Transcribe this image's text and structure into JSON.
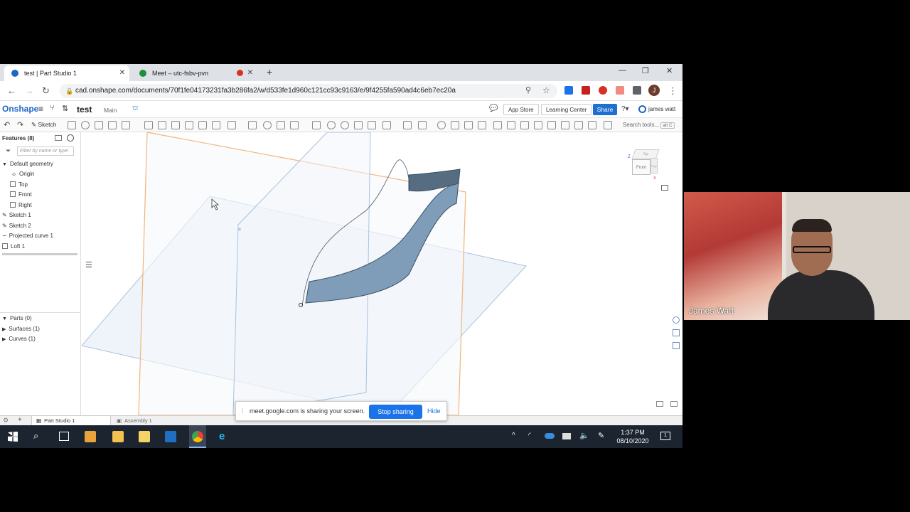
{
  "browser": {
    "tabs": [
      {
        "title": "test | Part Studio 1"
      },
      {
        "title": "Meet – utc-fsbv-pvn"
      }
    ],
    "url": "cad.onshape.com/documents/70f1fe04173231fa3b286fa2/w/d533fe1d960c121cc93c9163/e/9f4255fa590ad4c6eb7ec20a",
    "profile_initial": "J"
  },
  "onshape": {
    "logo": "Onshape",
    "document_name": "test",
    "workspace": "Main",
    "app_store": "App Store",
    "learning_center": "Learning Center",
    "share": "Share",
    "user": "james watt",
    "sketch_label": "Sketch",
    "search_tools": "Search tools...",
    "search_shortcut": "alt C"
  },
  "feature_panel": {
    "header": "Features (8)",
    "filter_placeholder": "Filter by name or type",
    "items": [
      {
        "label": "Default geometry"
      },
      {
        "label": "Origin"
      },
      {
        "label": "Top"
      },
      {
        "label": "Front"
      },
      {
        "label": "Right"
      },
      {
        "label": "Sketch 1"
      },
      {
        "label": "Sketch 2"
      },
      {
        "label": "Projected curve 1"
      },
      {
        "label": "Loft 1"
      }
    ],
    "parts": [
      {
        "label": "Parts (0)"
      },
      {
        "label": "Surfaces (1)"
      },
      {
        "label": "Curves (1)"
      }
    ]
  },
  "view_cube": {
    "top": "Top",
    "front": "Front",
    "right": "Right",
    "axis_z": "Z",
    "axis_x": "X"
  },
  "bottom_tabs": [
    {
      "label": "Part Studio 1"
    },
    {
      "label": "Assembly 1"
    }
  ],
  "share_bar": {
    "message": "meet.google.com is sharing your screen.",
    "stop": "Stop sharing",
    "hide": "Hide"
  },
  "taskbar": {
    "time": "1:37 PM",
    "date": "08/10/2020",
    "notification_count": "1"
  },
  "video": {
    "participant": "James Watt"
  },
  "colors": {
    "accent": "#1f6fd1",
    "surface": "#7f9db8",
    "plane_orange": "#f0b070",
    "plane_blue": "#9bb8d6"
  }
}
